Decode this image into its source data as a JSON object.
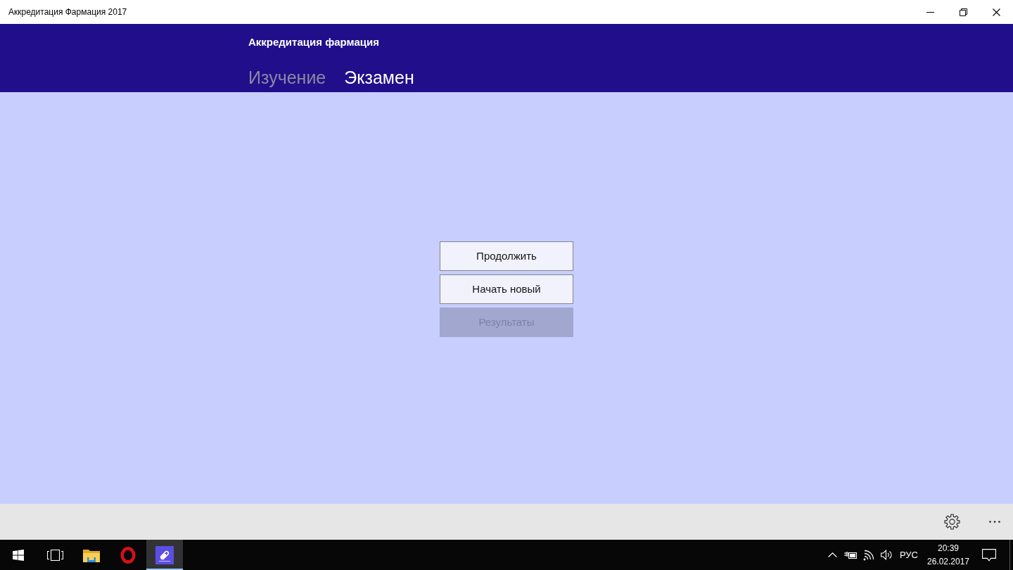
{
  "window": {
    "title": "Аккредитация Фармация 2017"
  },
  "header": {
    "title": "Аккредитация фармация",
    "tabs": [
      {
        "label": "Изучение",
        "selected": false
      },
      {
        "label": "Экзамен",
        "selected": true
      }
    ]
  },
  "actions": [
    {
      "label": "Продолжить",
      "disabled": false
    },
    {
      "label": "Начать новый",
      "disabled": false
    },
    {
      "label": "Результаты",
      "disabled": true
    }
  ],
  "taskbar": {
    "pinned": [
      {
        "kind": "folder",
        "selected": false
      },
      {
        "kind": "browser",
        "selected": false
      },
      {
        "kind": "app",
        "selected": true
      }
    ],
    "tray": {
      "language": "РУС",
      "time": "20:39",
      "date": "26.02.2017"
    }
  }
}
